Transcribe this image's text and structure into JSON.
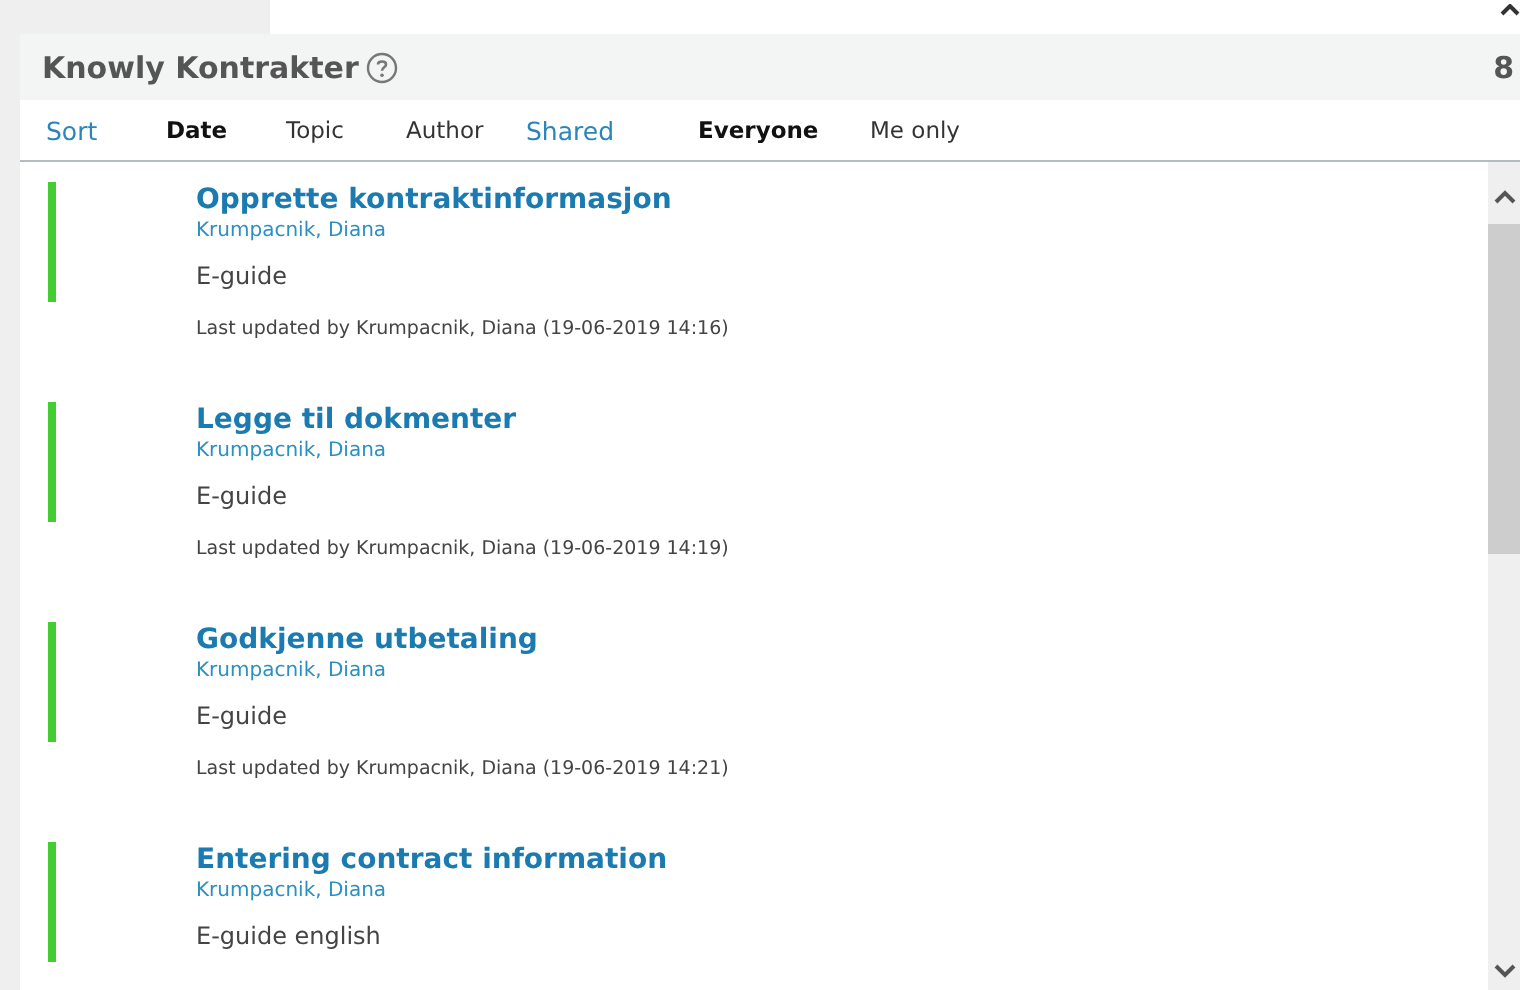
{
  "panel": {
    "title": "Knowly Kontrakter",
    "count": "8"
  },
  "sort": {
    "label": "Sort",
    "options": [
      {
        "label": "Date",
        "selected": true
      },
      {
        "label": "Topic",
        "selected": false
      },
      {
        "label": "Author",
        "selected": false
      }
    ]
  },
  "shared": {
    "label": "Shared",
    "options": [
      {
        "label": "Everyone",
        "selected": true
      },
      {
        "label": "Me only",
        "selected": false
      }
    ]
  },
  "items": [
    {
      "title": "Opprette kontraktinformasjon",
      "author": "Krumpacnik, Diana",
      "type": "E-guide",
      "updated": "Last updated by Krumpacnik, Diana (19-06-2019 14:16)",
      "color": "#44cc33"
    },
    {
      "title": "Legge til dokmenter",
      "author": "Krumpacnik, Diana",
      "type": "E-guide",
      "updated": "Last updated by Krumpacnik, Diana (19-06-2019 14:19)",
      "color": "#44cc33"
    },
    {
      "title": "Godkjenne utbetaling",
      "author": "Krumpacnik, Diana",
      "type": "E-guide",
      "updated": "Last updated by Krumpacnik, Diana (19-06-2019 14:21)",
      "color": "#44cc33"
    },
    {
      "title": "Entering contract information",
      "author": "Krumpacnik, Diana",
      "type": "E-guide english",
      "color": "#44cc33"
    }
  ]
}
